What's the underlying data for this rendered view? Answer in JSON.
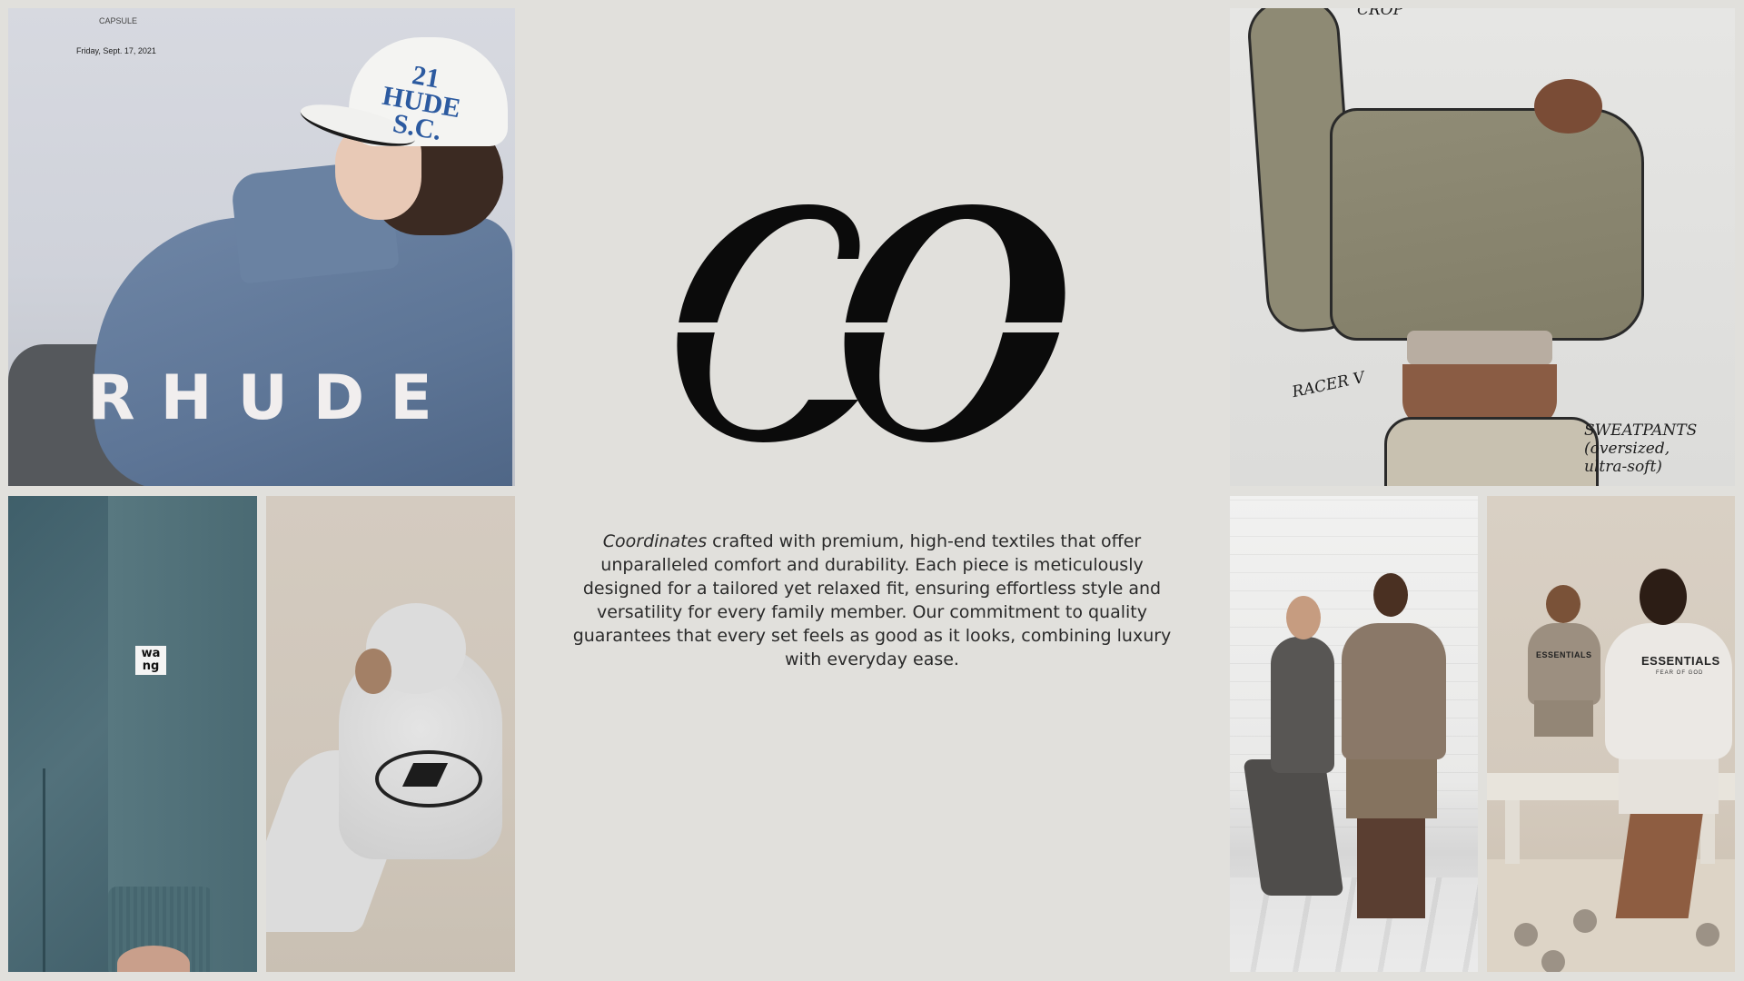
{
  "photos": {
    "rhude": {
      "brand_text": "RHUDE",
      "capsule_text": "CAPSULE",
      "date_text": "Friday, Sept. 17, 2021",
      "cap_text": "21\nHUDE\nS.C."
    },
    "wang": {
      "label_text": "wa\nng"
    },
    "sketch": {
      "note_top": "CROP",
      "note_racer": "RACER V",
      "note_sweatpants": "SWEATPANTS\n(oversized,\nultra-soft)"
    },
    "kids": {
      "essentials_small": "ESSENTIALS",
      "essentials_large": "ESSENTIALS",
      "essentials_sub": "FEAR OF GOD"
    }
  },
  "description": {
    "lead_italic": "Coordinates",
    "body": " crafted with premium, high-end textiles that offer unparalleled comfort and durability. Each piece is meticulously designed for a tailored yet relaxed fit, ensuring effortless style and versatility for every family member. Our commitment to quality guarantees that every set feels as good as it looks, combining luxury with everyday ease."
  },
  "colors": {
    "background": "#e1e0dc",
    "logo": "#0b0b0b",
    "text": "#2a2a2a"
  }
}
